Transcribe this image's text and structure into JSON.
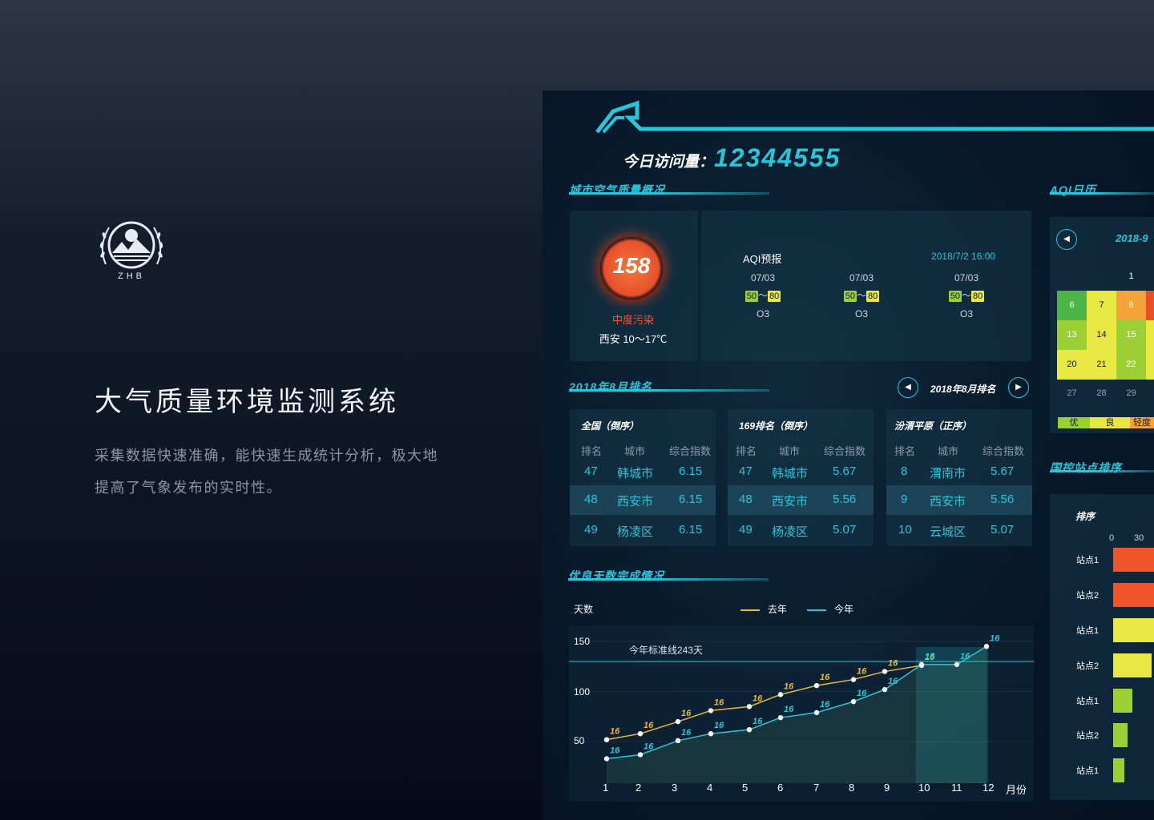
{
  "hero": {
    "logo_text": "ZHB",
    "title": "大气质量环境监测系统",
    "description": "采集数据快速准确，能快速生成统计分析，极大地提高了气象发布的实时性。"
  },
  "dashboard": {
    "visit_label": "今日访问量：",
    "visit_count": "12344555",
    "overview": {
      "title": "城市空气质量概况",
      "aqi_value": "158",
      "pollution_level": "中度污染",
      "weather": "西安 10～17℃",
      "forecast_title": "AQI预报",
      "forecast_time": "2018/7/2 16:00",
      "forecast": [
        {
          "date": "07/03",
          "low": "50",
          "tilde": "～",
          "high": "80",
          "pollutant": "O3"
        },
        {
          "date": "07/03",
          "low": "50",
          "tilde": "～",
          "high": "80",
          "pollutant": "O3"
        },
        {
          "date": "07/03",
          "low": "50",
          "tilde": "～",
          "high": "80",
          "pollutant": "O3"
        }
      ]
    },
    "ranking": {
      "title": "2018年8月排名",
      "nav_label": "2018年8月排名",
      "prev": "◀",
      "next": "▶",
      "tables": [
        {
          "title": "全国（倒序）",
          "headers": [
            "排名",
            "城市",
            "综合指数"
          ],
          "rows": [
            [
              "47",
              "韩城市",
              "6.15"
            ],
            [
              "48",
              "西安市",
              "6.15"
            ],
            [
              "49",
              "杨凌区",
              "6.15"
            ]
          ]
        },
        {
          "title": "169排名（倒序）",
          "headers": [
            "排名",
            "城市",
            "综合指数"
          ],
          "rows": [
            [
              "47",
              "韩城市",
              "5.67"
            ],
            [
              "48",
              "西安市",
              "5.56"
            ],
            [
              "49",
              "杨凌区",
              "5.07"
            ]
          ]
        },
        {
          "title": "汾渭平原（正序）",
          "headers": [
            "排名",
            "城市",
            "综合指数"
          ],
          "rows": [
            [
              "8",
              "渭南市",
              "5.67"
            ],
            [
              "9",
              "西安市",
              "5.56"
            ],
            [
              "10",
              "云城区",
              "5.07"
            ]
          ]
        }
      ]
    },
    "aqi_calendar": {
      "title": "AQI日历",
      "prev": "◀",
      "month": "2018-9",
      "days": [
        "1",
        "6",
        "7",
        "8",
        "13",
        "14",
        "15",
        "20",
        "21",
        "22",
        "27",
        "28",
        "29"
      ],
      "levels": [
        "优",
        "良",
        "轻度"
      ],
      "colors": {
        "good": "#4cb54a",
        "moderate": "#e9e843",
        "light": "#f2a33a",
        "heavy": "#e8502a"
      }
    },
    "station_rank": {
      "title": "国控站点排序",
      "header": "排序",
      "axis": [
        "0",
        "30"
      ],
      "stations": [
        "站点1",
        "站点2",
        "站点1",
        "站点2",
        "站点1",
        "站点2",
        "站点1"
      ]
    },
    "good_days": {
      "title": "优良天数完成情况",
      "y_label": "天数",
      "x_unit": "月份",
      "legend_last_year": "去年",
      "legend_this_year": "今年",
      "std_line_label": "今年标准线243天"
    }
  },
  "chart_data": {
    "type": "line",
    "title": "优良天数完成情况",
    "ylabel": "天数",
    "xlabel": "月份",
    "x": [
      1,
      2,
      3,
      4,
      5,
      6,
      7,
      8,
      9,
      10,
      11,
      12
    ],
    "yticks": [
      50,
      100,
      150
    ],
    "ylim": [
      30,
      170
    ],
    "reference_line": {
      "label": "今年标准线243天",
      "value": 130
    },
    "data_label": "16",
    "series": [
      {
        "name": "去年",
        "color": "#e9b93a",
        "values": [
          52,
          58,
          70,
          81,
          85,
          97,
          106,
          112,
          120,
          126,
          null,
          null
        ]
      },
      {
        "name": "今年",
        "color": "#25c7d9",
        "values": [
          33,
          37,
          51,
          58,
          62,
          74,
          79,
          90,
          102,
          127,
          127,
          145
        ]
      }
    ]
  }
}
